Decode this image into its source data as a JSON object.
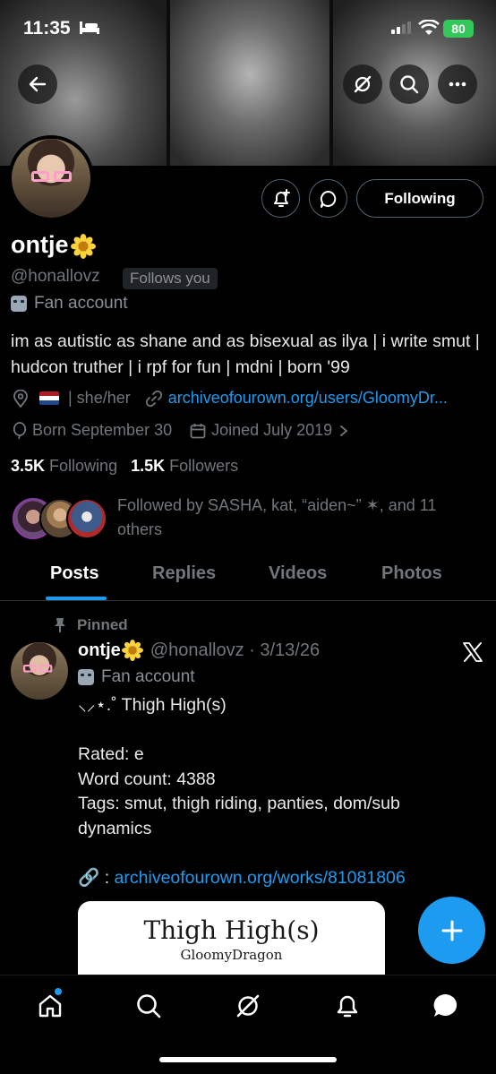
{
  "status_bar": {
    "time": "11:35",
    "battery": "80"
  },
  "profile": {
    "display_name": "ontje",
    "handle": "@honallovz",
    "follows_you": "Follows you",
    "account_label": "Fan account",
    "bio": "im as autistic as shane and as bisexual as ilya | i write smut | hudcon truther | i rpf for fun | mdni | born '99",
    "pronouns": "| she/her",
    "website": "archiveofourown.org/users/GloomyDr...",
    "birthday": "Born September 30",
    "joined": "Joined July 2019",
    "following_count": "3.5K",
    "following_label": "Following",
    "followers_count": "1.5K",
    "followers_label": "Followers",
    "followed_by": "Followed by SASHA, kat, “aiden~” ✶, and 11 others"
  },
  "actions": {
    "following_button": "Following"
  },
  "tabs": [
    {
      "label": "Posts",
      "active": true
    },
    {
      "label": "Replies",
      "active": false
    },
    {
      "label": "Videos",
      "active": false
    },
    {
      "label": "Photos",
      "active": false
    }
  ],
  "post": {
    "pinned_label": "Pinned",
    "author_name": "ontje",
    "author_handle": "@honallovz",
    "date": "3/13/26",
    "account_label": "Fan account",
    "lines": [
      "⸜⸝⋆.˚ Thigh High(s)",
      "",
      "Rated: e",
      "Word count: 4388",
      "Tags: smut, thigh riding, panties, dom/sub dynamics",
      ""
    ],
    "link_prefix": "🔗 : ",
    "link": "archiveofourown.org/works/81081806",
    "card": {
      "title": "Thigh High(s)",
      "author": "GloomyDragon"
    }
  },
  "colors": {
    "accent": "#1d9bf0",
    "background": "#000000",
    "muted": "#71767b"
  },
  "icons": [
    "back-arrow-icon",
    "grok-icon",
    "search-icon",
    "more-icon",
    "notification-add-icon",
    "message-icon",
    "location-icon",
    "link-icon",
    "balloon-icon",
    "calendar-icon",
    "pin-icon",
    "x-logo-icon",
    "plus-icon",
    "home-icon",
    "bell-icon",
    "chat-icon"
  ]
}
